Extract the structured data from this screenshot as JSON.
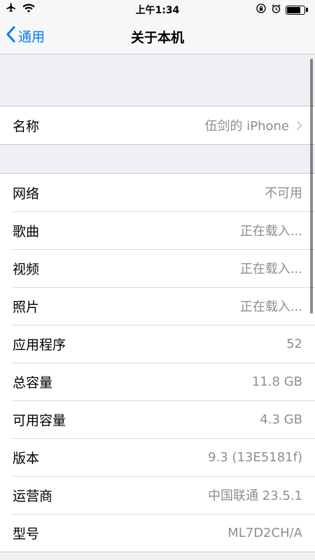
{
  "status_bar": {
    "time": "上午1:34"
  },
  "nav": {
    "back_label": "通用",
    "title": "关于本机"
  },
  "name_row": {
    "label": "名称",
    "value": "伍剑的 iPhone"
  },
  "info_rows": [
    {
      "label": "网络",
      "value": "不可用"
    },
    {
      "label": "歌曲",
      "value": "正在载入..."
    },
    {
      "label": "视频",
      "value": "正在载入..."
    },
    {
      "label": "照片",
      "value": "正在载入..."
    },
    {
      "label": "应用程序",
      "value": "52"
    },
    {
      "label": "总容量",
      "value": "11.8 GB"
    },
    {
      "label": "可用容量",
      "value": "4.3 GB"
    },
    {
      "label": "版本",
      "value": "9.3 (13E5181f)"
    },
    {
      "label": "运营商",
      "value": "中国联通 23.5.1"
    },
    {
      "label": "型号",
      "value": "ML7D2CH/A"
    }
  ],
  "colors": {
    "accent": "#007aff",
    "background": "#efeff4",
    "secondary_text": "#8e8e93"
  },
  "icons": [
    "airplane-icon",
    "wifi-icon",
    "orientation-lock-icon",
    "alarm-icon",
    "battery-icon",
    "back-chevron-icon",
    "disclosure-chevron-icon"
  ]
}
